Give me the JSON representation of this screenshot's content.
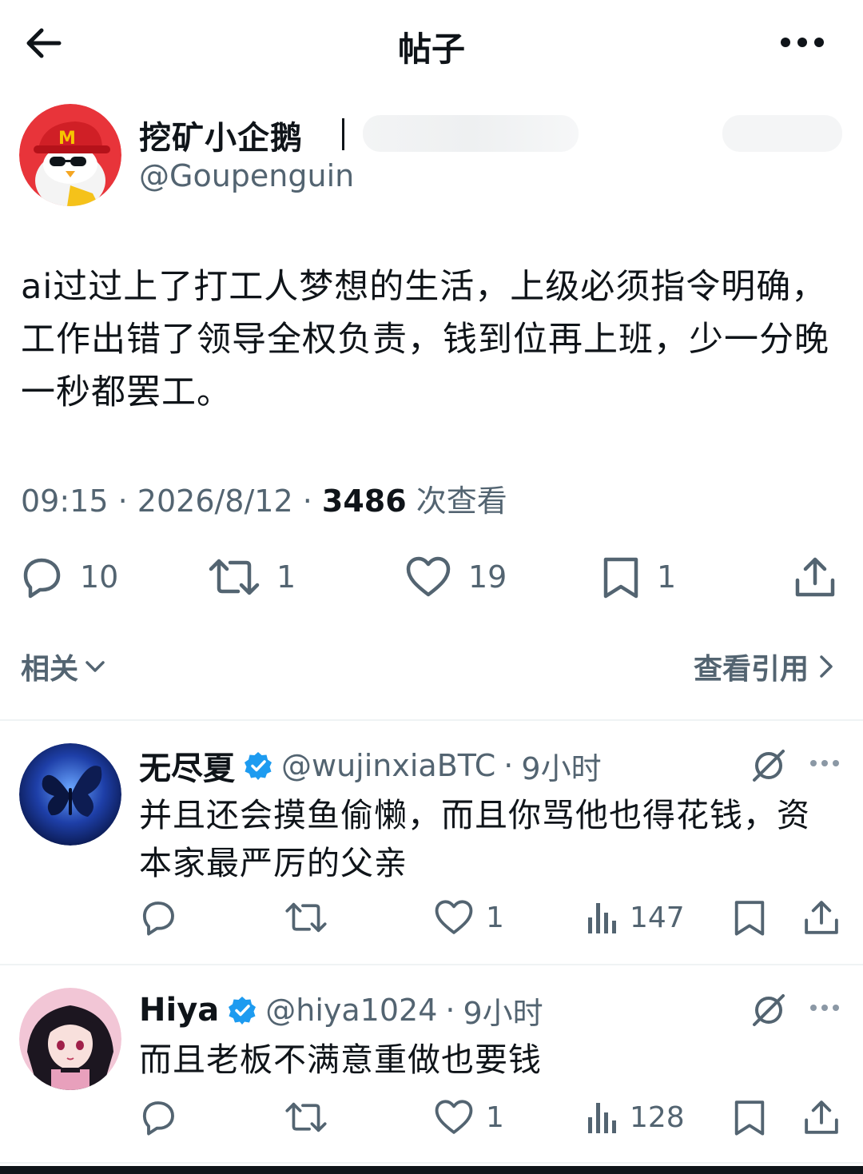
{
  "topbar": {
    "title": "帖子"
  },
  "post": {
    "author_name": "挖矿小企鹅",
    "author_handle": "@Goupenguin",
    "text": "ai过过上了打工人梦想的生活，上级必须指令明确，工作出错了领导全权负责，钱到位再上班，少一分晚一秒都罢工。",
    "time": "09:15",
    "date": "2026/8/12",
    "views": "3486",
    "views_label": "次查看",
    "sep": "·",
    "stats": {
      "replies": "10",
      "reposts": "1",
      "likes": "19",
      "bookmarks": "1"
    }
  },
  "related": {
    "label": "相关",
    "quotes_label": "查看引用"
  },
  "replies": [
    {
      "name": "无尽夏",
      "handle": "@wujinxiaBTC",
      "time": "9小时",
      "sep": "·",
      "text": "并且还会摸鱼偷懒，而且你骂他也得花钱，资本家最严厉的父亲",
      "likes": "1",
      "views": "147"
    },
    {
      "name": "Hiya",
      "handle": "@hiya1024",
      "time": "9小时",
      "sep": "·",
      "text": "而且老板不满意重做也要钱",
      "likes": "1",
      "views": "128"
    }
  ],
  "colors": {
    "text": "#0f1419",
    "muted": "#536471",
    "verified": "#1d9bf0",
    "divider": "#eff3f4"
  },
  "icons": [
    "back-arrow-icon",
    "more-icon",
    "reply-icon",
    "repost-icon",
    "like-icon",
    "bookmark-icon",
    "share-icon",
    "views-icon",
    "verified-icon",
    "grok-icon",
    "chevron-down-icon",
    "chevron-right-icon"
  ]
}
